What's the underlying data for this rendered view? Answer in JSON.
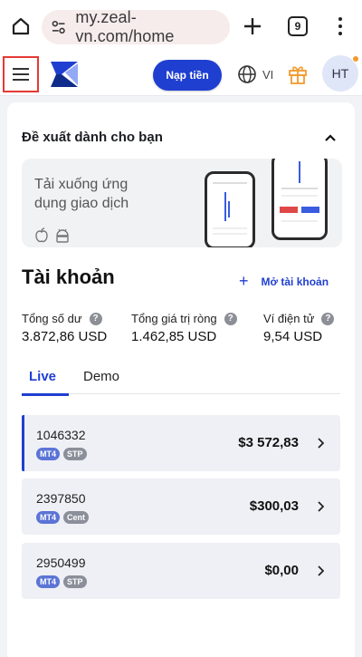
{
  "browser": {
    "url": "my.zeal-vn.com/home",
    "tab_count": "9"
  },
  "header": {
    "deposit_label": "Nạp tiền",
    "language": "VI",
    "avatar_initials": "HT"
  },
  "recommendations": {
    "title": "Đề xuất dành cho bạn",
    "banner_text": "Tải xuống ứng dụng giao dịch"
  },
  "accounts": {
    "title": "Tài khoản",
    "open_account_label": "Mở tài khoản",
    "stats": [
      {
        "label": "Tổng số dư",
        "value": "3.872,86 USD"
      },
      {
        "label": "Tổng giá trị ròng",
        "value": "1.462,85 USD"
      },
      {
        "label": "Ví điện tử",
        "value": "9,54 USD"
      }
    ],
    "tabs": [
      {
        "label": "Live"
      },
      {
        "label": "Demo"
      }
    ],
    "list": [
      {
        "number": "1046332",
        "platform": "MT4",
        "type": "STP",
        "balance": "$3 572,83"
      },
      {
        "number": "2397850",
        "platform": "MT4",
        "type": "Cent",
        "balance": "$300,03"
      },
      {
        "number": "2950499",
        "platform": "MT4",
        "type": "STP",
        "balance": "$0,00"
      }
    ]
  },
  "colors": {
    "accent": "#1f3fd1",
    "highlight_border": "#e53935",
    "notification_dot": "#f29a2e"
  }
}
